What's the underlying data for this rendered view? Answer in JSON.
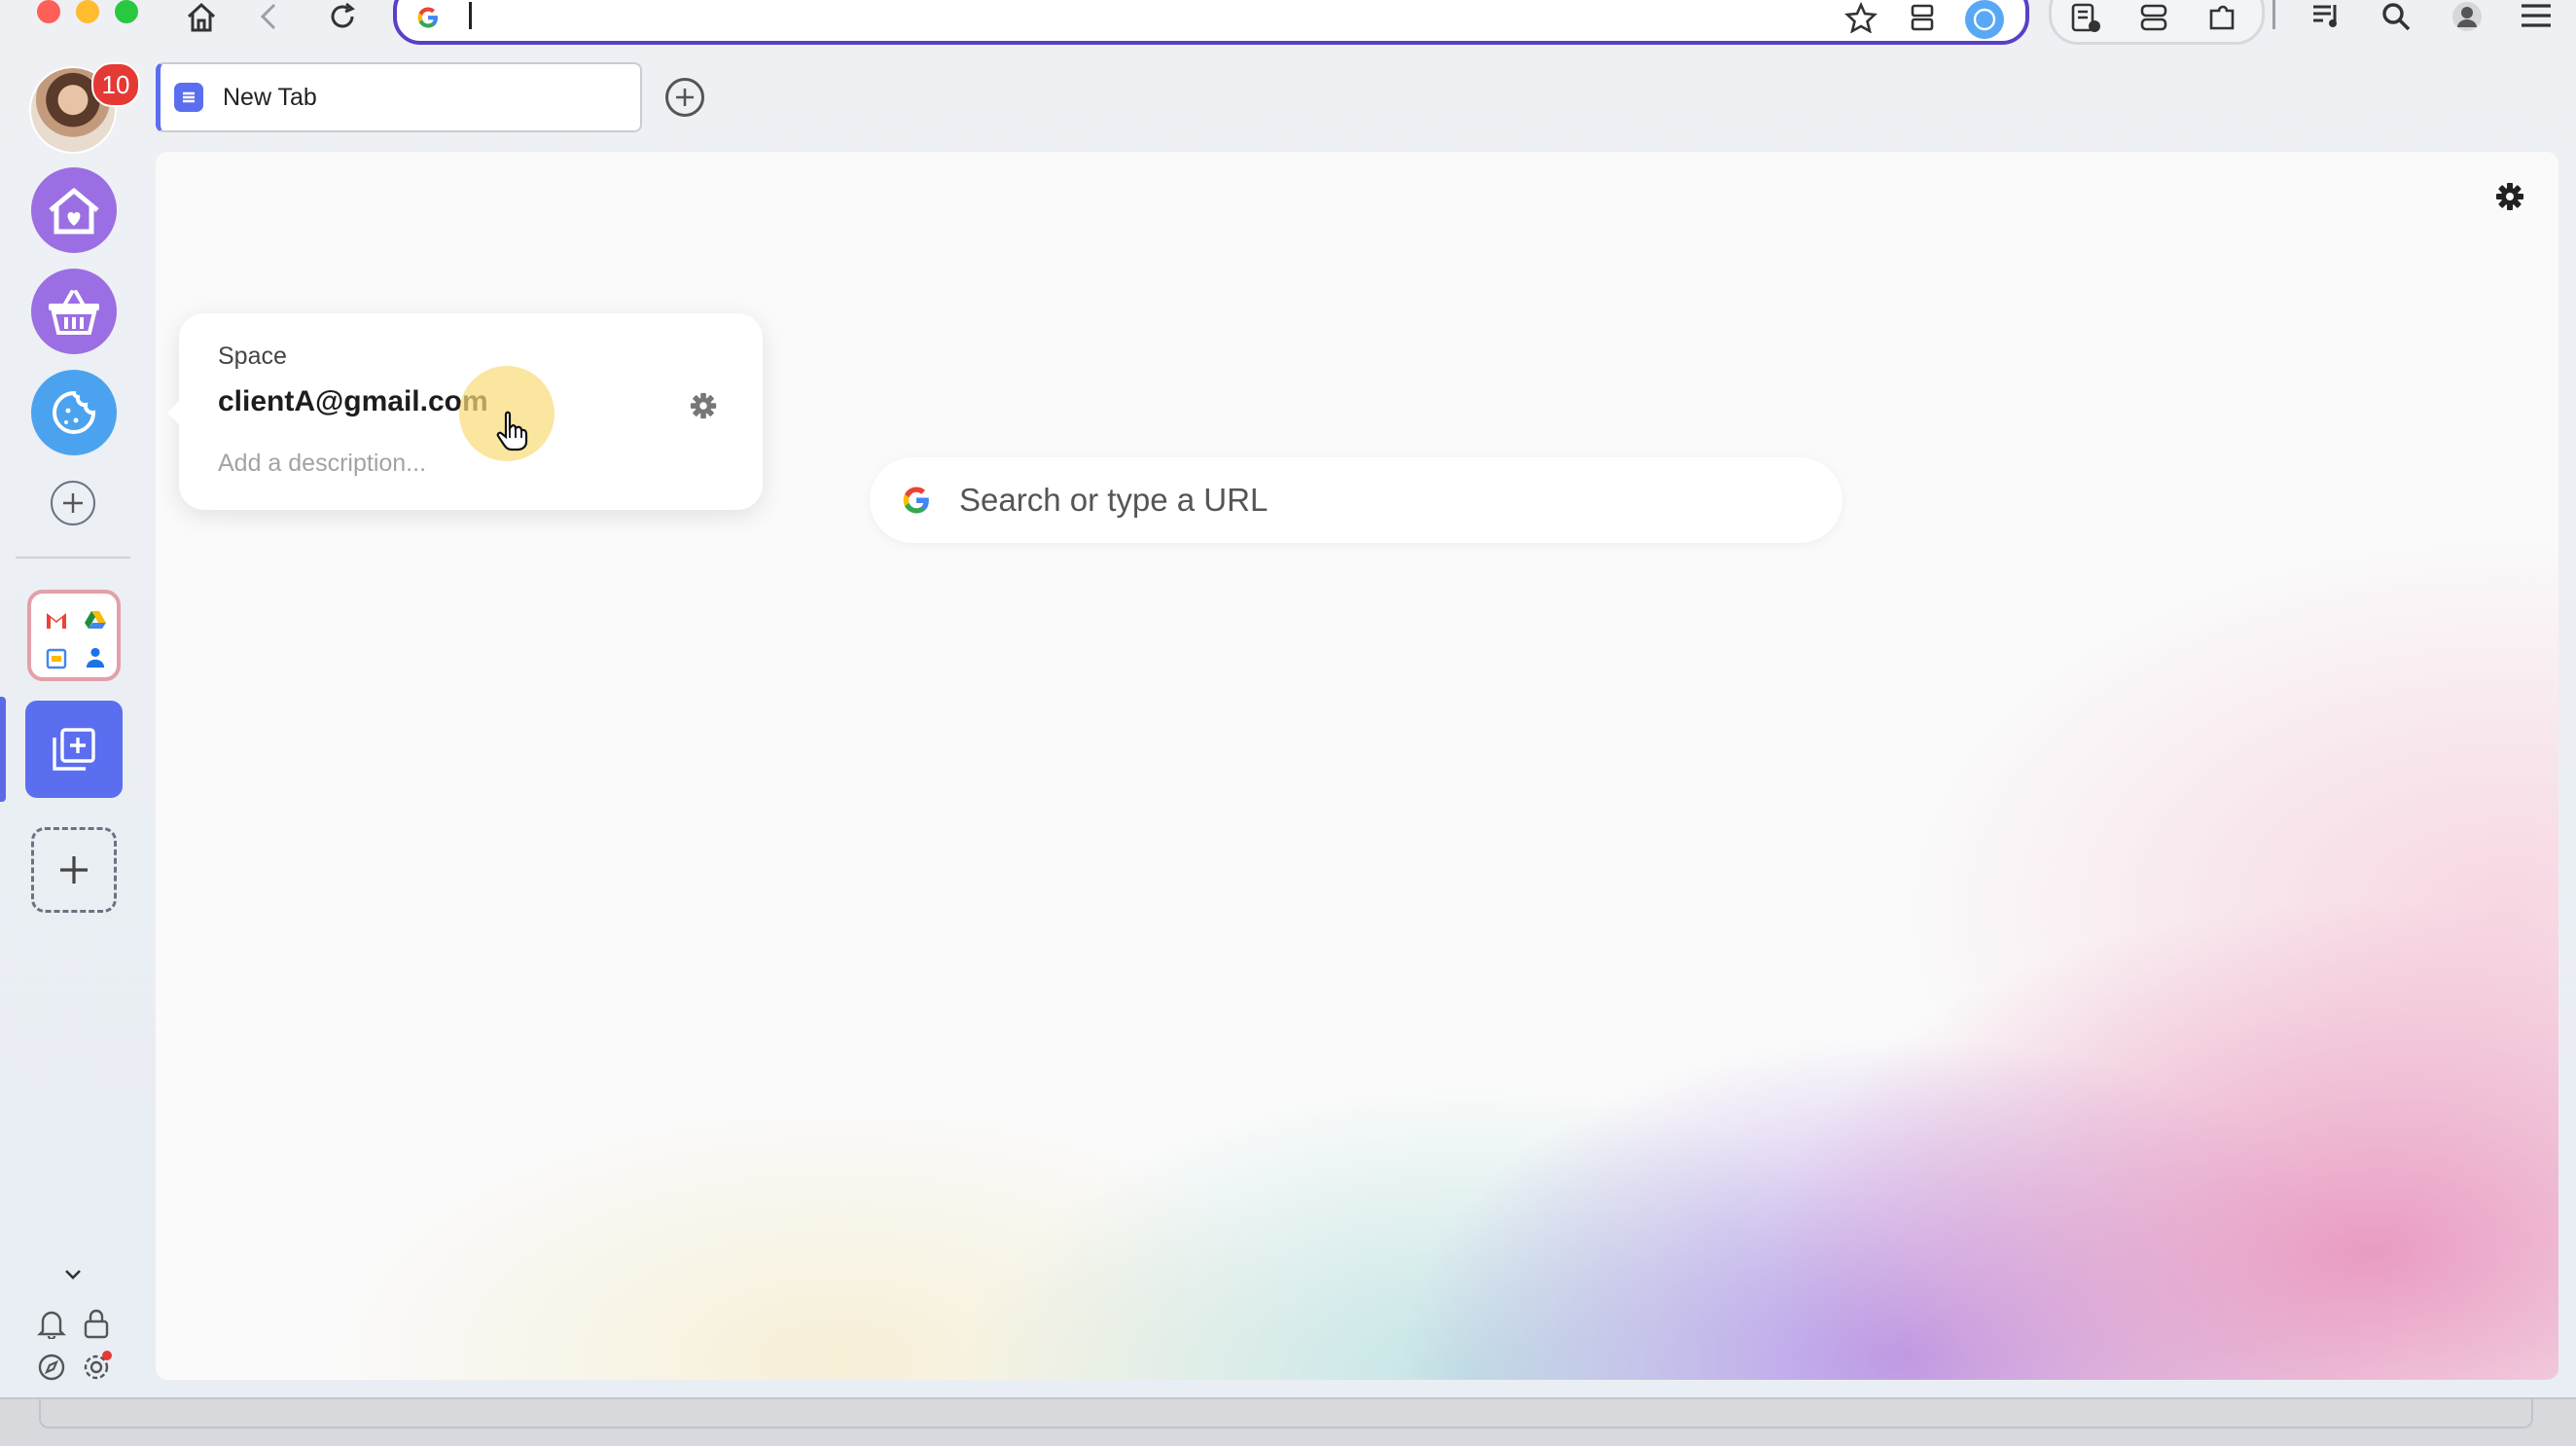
{
  "browser": {
    "address_bar": {
      "value": "",
      "placeholder": ""
    },
    "tabs": [
      {
        "title": "New Tab"
      }
    ]
  },
  "sidebar": {
    "notification_count": "10",
    "spaces": [
      {
        "icon": "home-heart-icon",
        "color": "#9b6fe3"
      },
      {
        "icon": "basket-icon",
        "color": "#9b6fe3"
      },
      {
        "icon": "cookie-icon",
        "color": "#4ba3ef"
      }
    ]
  },
  "space_popover": {
    "label": "Space",
    "name": "clientA@gmail.com",
    "description_placeholder": "Add a description..."
  },
  "search": {
    "placeholder": "Search or type a URL"
  },
  "colors": {
    "accent": "#5c6ef0",
    "omnibox_border": "#5b3fc6",
    "badge": "#e53935"
  }
}
